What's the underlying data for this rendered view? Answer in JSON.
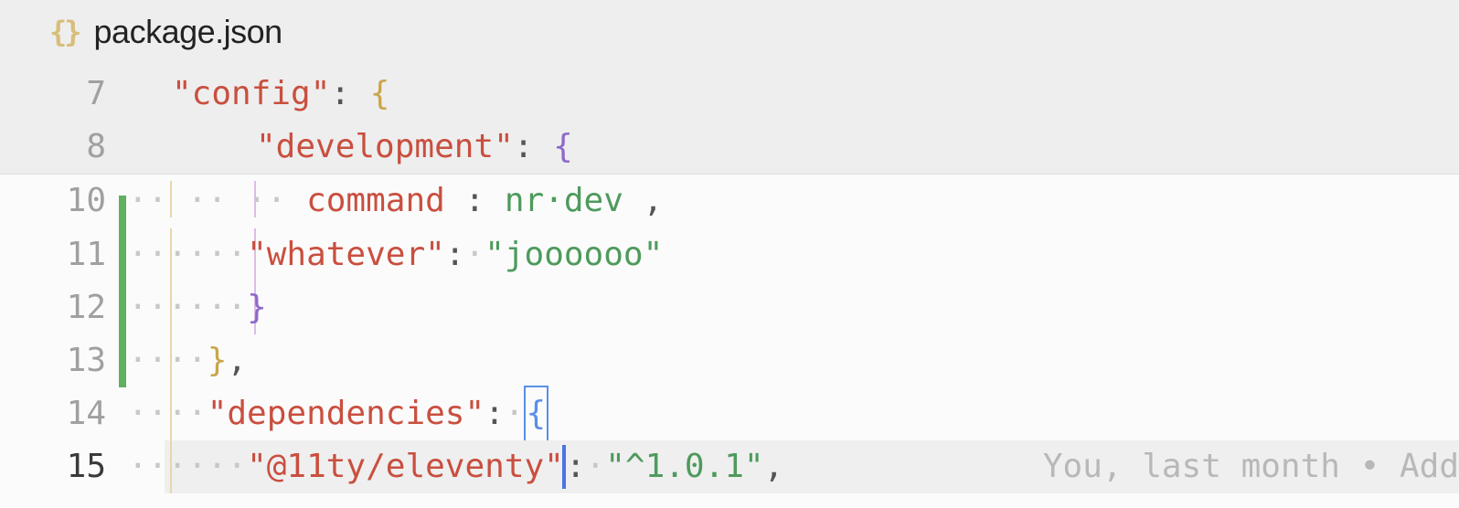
{
  "tab": {
    "icon": "braces",
    "filename": "package.json"
  },
  "sticky": [
    {
      "lineNo": "7",
      "indentDots": "····",
      "key": "\"config\"",
      "colon": ": ",
      "brace": "{",
      "braceClass": "tok-brace-o"
    },
    {
      "lineNo": "8",
      "indentDots": "······",
      "key": "\"development\"",
      "colon": ": ",
      "brace": "{",
      "braceClass": "tok-brace-p"
    }
  ],
  "lines": {
    "l10": {
      "num": "10",
      "dots": "········",
      "key": "command",
      "colon": " : ",
      "str": "nr·dev",
      "trail": " ,"
    },
    "l11": {
      "num": "11",
      "dots": "····",
      "dots2": "··",
      "key": "\"whatever\"",
      "colon": ":",
      "gapDot": "·",
      "str": "\"joooooo\""
    },
    "l12": {
      "num": "12",
      "dots": "····",
      "dots2": "··",
      "brace": "}"
    },
    "l13": {
      "num": "13",
      "dots": "····",
      "brace": "}",
      "trail": ","
    },
    "l14": {
      "num": "14",
      "dots": "····",
      "key": "\"dependencies\"",
      "colon": ":",
      "gapDot": "·",
      "brace": "{"
    },
    "l15": {
      "num": "15",
      "dots": "····",
      "dots2": "··",
      "key": "\"@11ty/eleventy\"",
      "colon": ":",
      "gapDot": "·",
      "str": "\"^1.0.1\"",
      "trail": ","
    }
  },
  "blame": "You, last month • Add"
}
